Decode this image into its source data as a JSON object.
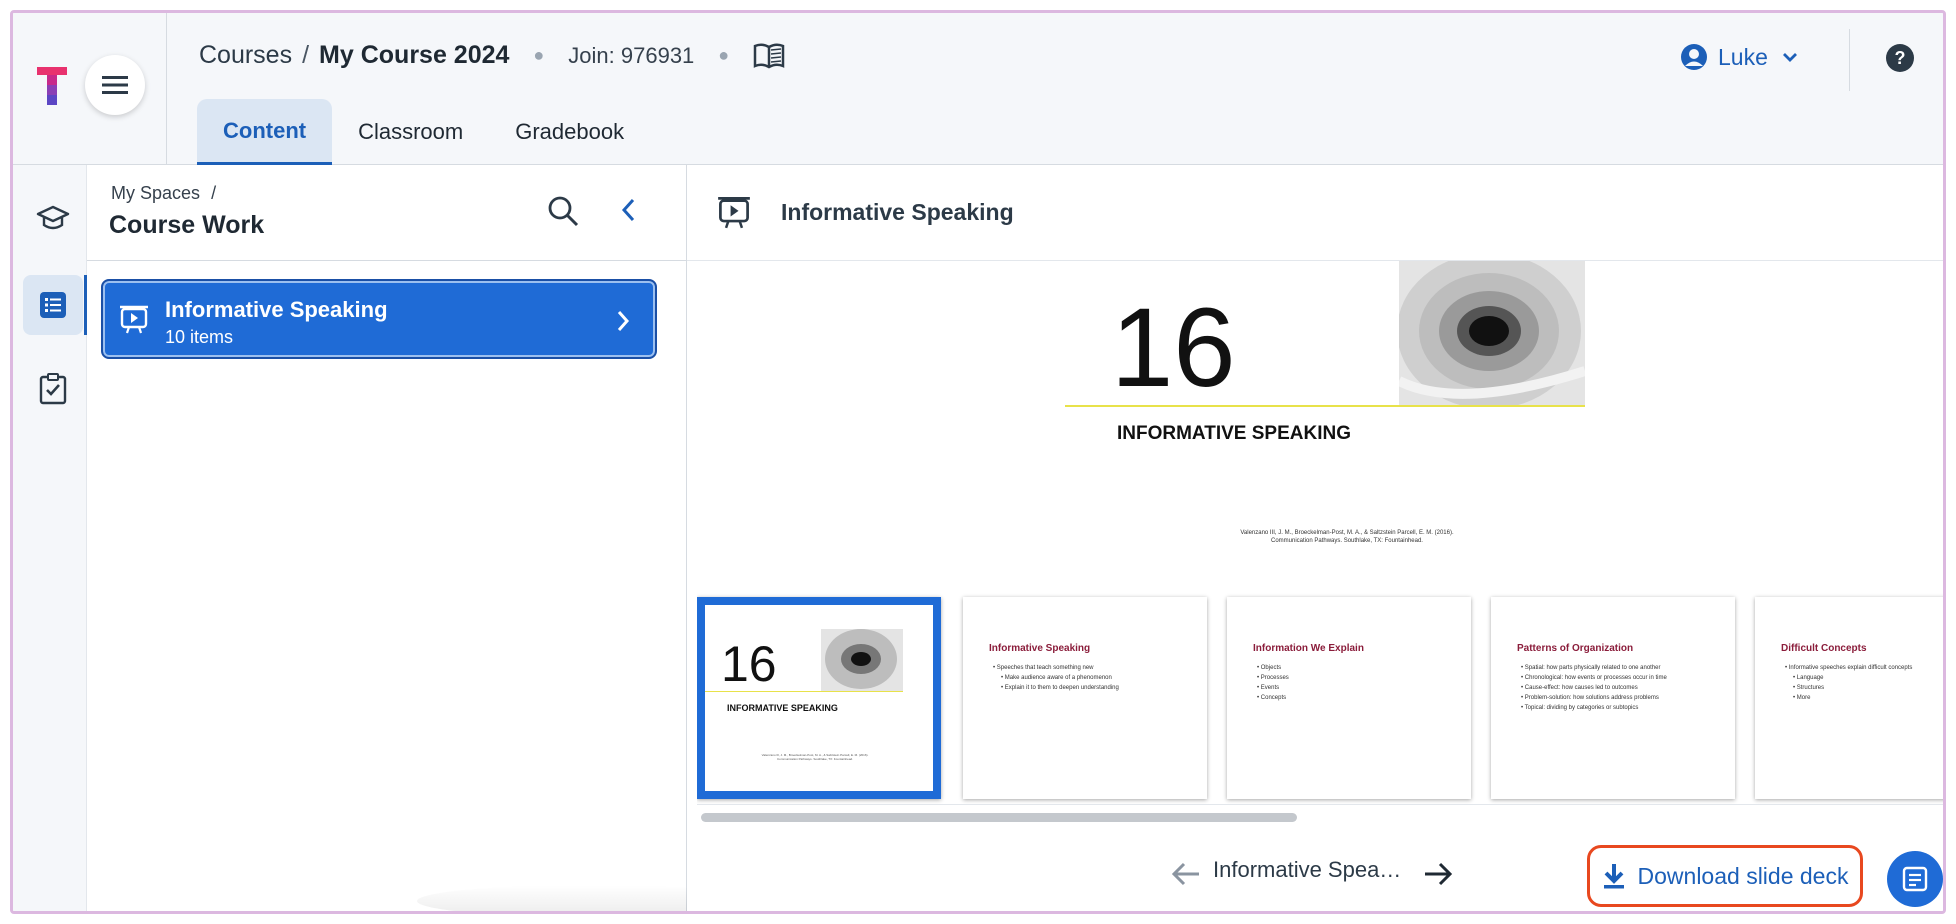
{
  "header": {
    "breadcrumb": {
      "courses": "Courses",
      "separator": "/",
      "course": "My Course 2024"
    },
    "join_code": "Join: 976931",
    "tabs": [
      {
        "label": "Content",
        "active": true
      },
      {
        "label": "Classroom",
        "active": false
      },
      {
        "label": "Gradebook",
        "active": false
      }
    ],
    "user": {
      "name": "Luke"
    }
  },
  "rail": {
    "items": [
      {
        "icon": "graduation-cap-icon",
        "active": false
      },
      {
        "icon": "list-icon",
        "active": true
      },
      {
        "icon": "clipboard-check-icon",
        "active": false
      }
    ]
  },
  "panel": {
    "breadcrumb": "My Spaces",
    "breadcrumb_sep": "/",
    "title": "Course Work",
    "folder": {
      "title": "Informative Speaking",
      "subtitle": "10 items"
    }
  },
  "content": {
    "title": "Informative Speaking",
    "main_slide": {
      "number": "16",
      "title": "INFORMATIVE SPEAKING",
      "citation_line1": "Valenzano III, J. M., Broeckelman-Post, M. A., & Saltzstein Parcell, E. M. (2016).",
      "citation_line2": "Communication Pathways. Southlake, TX: Fountainhead."
    },
    "thumbnails": [
      {
        "type": "title",
        "number": "16",
        "title": "INFORMATIVE SPEAKING",
        "selected": true
      },
      {
        "type": "text",
        "heading": "Informative Speaking",
        "bullets": [
          "• Speeches that teach something new",
          "   • Make audience aware of a phenomenon",
          "   • Explain it to them to deepen understanding"
        ]
      },
      {
        "type": "text",
        "heading": "Information We Explain",
        "bullets": [
          "• Objects",
          "• Processes",
          "• Events",
          "• Concepts"
        ]
      },
      {
        "type": "text",
        "heading": "Patterns of Organization",
        "bullets": [
          "• Spatial: how parts physically related to one another",
          "• Chronological: how events or processes occur in time",
          "• Cause-effect: how causes led to outcomes",
          "• Problem-solution: how solutions address problems",
          "• Topical: dividing by categories or subtopics"
        ]
      },
      {
        "type": "text",
        "heading": "Difficult Concepts",
        "bullets": [
          "• Informative speeches explain difficult concepts",
          "   • Language",
          "   • Structures",
          "   • More"
        ]
      }
    ],
    "scroll_position": 0.0,
    "nav_label": "Informative Spea…",
    "download_label": "Download slide deck"
  },
  "colors": {
    "accent": "#1f6bd6",
    "highlight_border": "#e8481f",
    "slide_heading": "#8b1d3b",
    "slide_rule": "#e8e24a"
  }
}
